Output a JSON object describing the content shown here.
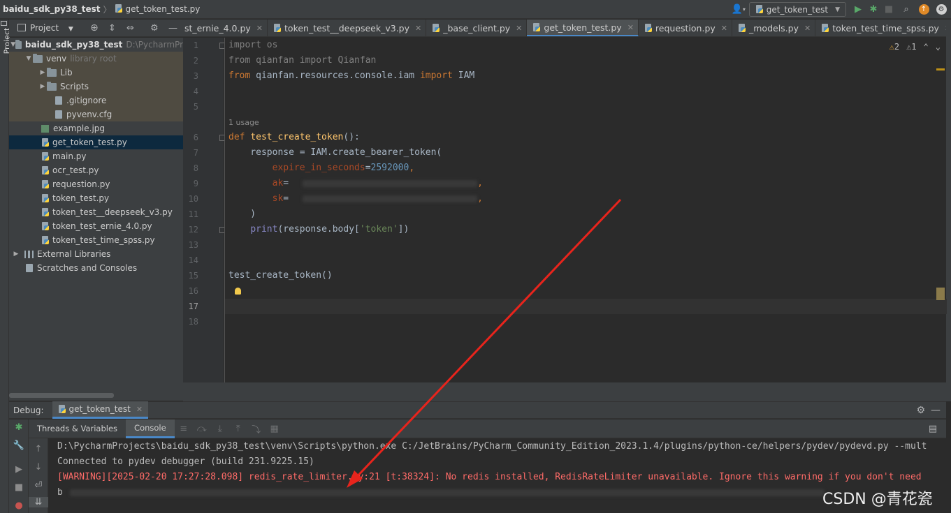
{
  "topbar": {
    "project_name": "baidu_sdk_py38_test",
    "current_file": "get_token_test.py",
    "run_config": "get_token_test",
    "icons": [
      "user-icon",
      "run-icon",
      "debug-icon",
      "stop-icon",
      "search-icon",
      "update-icon",
      "settings-icon"
    ]
  },
  "left_strip": {
    "label": "Project"
  },
  "project_panel": {
    "title": "Project",
    "root_label": "baidu_sdk_py38_test",
    "root_path": "D:\\PycharmPr",
    "venv_label": "venv",
    "venv_hint": "library root",
    "lib": "Lib",
    "scripts": "Scripts",
    "gitignore": ".gitignore",
    "pyvenv": "pyvenv.cfg",
    "files": [
      "example.jpg",
      "get_token_test.py",
      "main.py",
      "ocr_test.py",
      "requestion.py",
      "token_test.py",
      "token_test__deepseek_v3.py",
      "token_test_ernie_4.0.py",
      "token_test_time_spss.py"
    ],
    "external_libraries": "External Libraries",
    "scratches": "Scratches and Consoles"
  },
  "tabs": [
    "st_ernie_4.0.py",
    "token_test__deepseek_v3.py",
    "_base_client.py",
    "get_token_test.py",
    "requestion.py",
    "_models.py",
    "token_test_time_spss.py"
  ],
  "active_tab": "get_token_test.py",
  "inspections": {
    "warnings": "2",
    "weak_warnings": "1"
  },
  "editor": {
    "line_numbers": [
      "1",
      "2",
      "3",
      "4",
      "5",
      "6",
      "7",
      "8",
      "9",
      "10",
      "11",
      "12",
      "13",
      "14",
      "15",
      "16",
      "17",
      "18"
    ],
    "usage_hint": "1 usage",
    "code": {
      "l1_kw": "import",
      "l1_rest": " os",
      "l2_kw": "from",
      "l2_mid": " qianfan ",
      "l2_kw2": "import",
      "l2_rest": " Qianfan",
      "l3_kw": "from",
      "l3_mid": " qianfan.resources.console.iam ",
      "l3_kw2": "import",
      "l3_rest": " IAM",
      "l6_kw": "def",
      "l6_fn": "test_create_token",
      "l6_rest": "():",
      "l7": "    response = IAM.create_bearer_token(",
      "l8_param": "expire_in_seconds",
      "l8_eq": "=",
      "l8_num": "2592000",
      "l8_end": ",",
      "l9_param": "ak",
      "l9_eq": "=",
      "l10_param": "sk",
      "l10_eq": "=",
      "comma": ",",
      "l11": "    )",
      "l12_bi": "print",
      "l12_mid": "(response.body[",
      "l12_str": "'token'",
      "l12_end": "])",
      "l15": "test_create_token()"
    }
  },
  "debug": {
    "label": "Debug:",
    "session_tab": "get_token_test",
    "subtabs": [
      "Threads & Variables",
      "Console"
    ],
    "console_lines": [
      "D:\\PycharmProjects\\baidu_sdk_py38_test\\venv\\Scripts\\python.exe C:/JetBrains/PyCharm_Community_Edition_2023.1.4/plugins/python-ce/helpers/pydev/pydevd.py --mult",
      "Connected to pydev debugger (build 231.9225.15)",
      "[WARNING][2025-02-20 17:27:28.098] redis_rate_limiter.py:21 [t:38324]: No redis installed, RedisRateLimiter unavailable. Ignore this warning if you don't need",
      "b"
    ]
  },
  "watermark": "CSDN @青花瓷",
  "colors": {
    "accent": "#4a88c7",
    "annotation_arrow": "#e8241c",
    "warning_text": "#ff6b68"
  }
}
